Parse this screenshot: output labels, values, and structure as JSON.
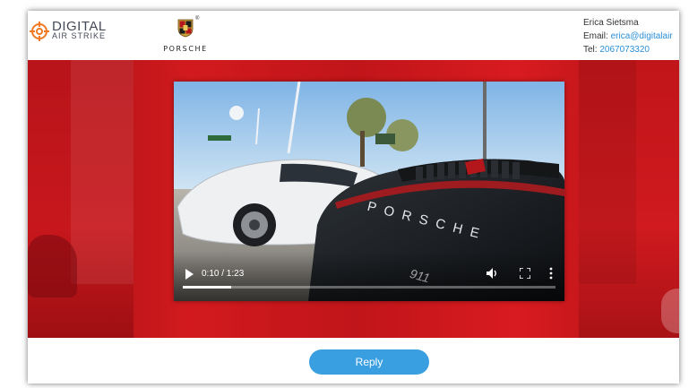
{
  "header": {
    "brand_line1": "DIGITAL",
    "brand_line2": "AIR STRIKE",
    "partner_logo_text": "PORSCHE",
    "registered_mark": "®"
  },
  "contact": {
    "name": "Erica Sietsma",
    "email_label": "Email:",
    "email_value": "erica@digitalair",
    "tel_label": "Tel:",
    "tel_value": "2067073320"
  },
  "video": {
    "elapsed": "0:10",
    "duration": "1:23",
    "time_display": "0:10 / 1:23",
    "progress_fraction": 0.13,
    "play_icon": "play-icon",
    "volume_icon": "volume-icon",
    "fullscreen_icon": "fullscreen-icon",
    "more_icon": "more-options-icon"
  },
  "footer": {
    "reply_label": "Reply"
  },
  "colors": {
    "accent_blue": "#3a9fe0",
    "link_blue": "#2b8fd8",
    "hero_red": "#c8171c",
    "brand_orange": "#f07a21"
  }
}
